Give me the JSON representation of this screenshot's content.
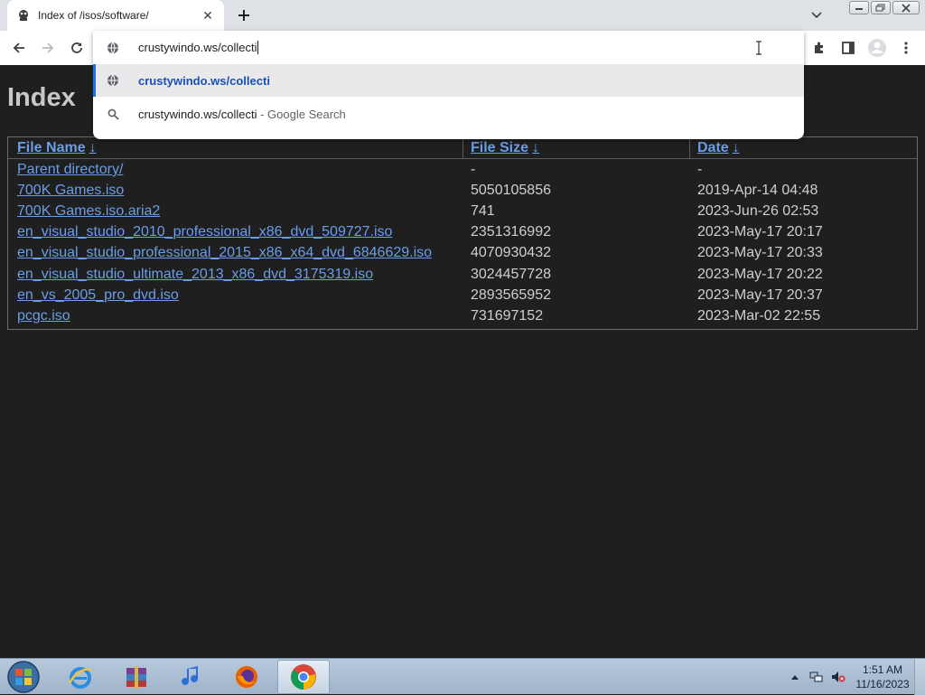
{
  "browser": {
    "tab_title": "Index of /isos/software/",
    "omnibox_text": "crustywindo.ws/collecti",
    "suggestions": [
      {
        "text": "crustywindo.ws/collecti",
        "suffix": ""
      },
      {
        "text": "crustywindo.ws/collecti",
        "suffix": " - Google Search"
      }
    ]
  },
  "page": {
    "title": "Index",
    "headers": {
      "name": "File Name",
      "size": "File Size",
      "date": "Date",
      "sort_arrow": "↓"
    },
    "rows": [
      {
        "name": "Parent directory/",
        "size": "-",
        "date": "-"
      },
      {
        "name": "700K Games.iso",
        "size": "5050105856",
        "date": "2019-Apr-14 04:48"
      },
      {
        "name": "700K Games.iso.aria2",
        "size": "741",
        "date": "2023-Jun-26 02:53"
      },
      {
        "name": "en_visual_studio_2010_professional_x86_dvd_509727.iso",
        "size": "2351316992",
        "date": "2023-May-17 20:17"
      },
      {
        "name": "en_visual_studio_professional_2015_x86_x64_dvd_6846629.iso",
        "size": "4070930432",
        "date": "2023-May-17 20:33"
      },
      {
        "name": "en_visual_studio_ultimate_2013_x86_dvd_3175319.iso",
        "size": "3024457728",
        "date": "2023-May-17 20:22"
      },
      {
        "name": "en_vs_2005_pro_dvd.iso",
        "size": "2893565952",
        "date": "2023-May-17 20:37"
      },
      {
        "name": "pcgc.iso",
        "size": "731697152",
        "date": "2023-Mar-02 22:55"
      }
    ]
  },
  "taskbar": {
    "apps": [
      "internet-explorer",
      "winrar",
      "itunes",
      "firefox",
      "chrome"
    ],
    "time": "1:51 AM",
    "date": "11/16/2023"
  },
  "colors": {
    "link": "#6a9ee8",
    "page_bg": "#1f1f1f",
    "accent": "#1a73e8"
  }
}
